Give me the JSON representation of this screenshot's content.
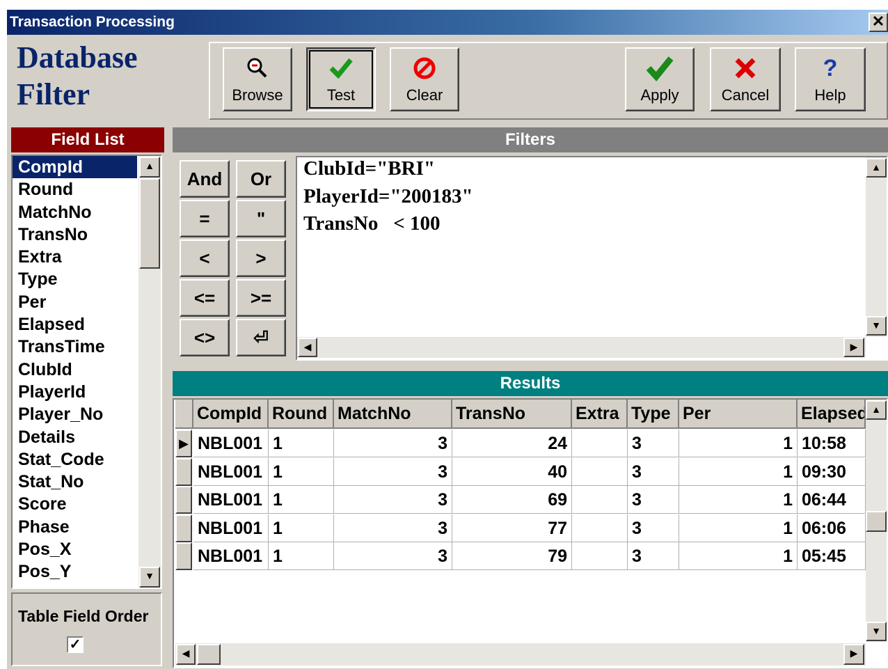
{
  "window": {
    "title": "Transaction Processing",
    "close_glyph": "✕"
  },
  "brand": {
    "line1": "Database",
    "line2": "Filter"
  },
  "toolbar": {
    "browse": "Browse",
    "test": "Test",
    "clear": "Clear",
    "apply": "Apply",
    "cancel": "Cancel",
    "help": "Help"
  },
  "field_list": {
    "header": "Field List",
    "items": [
      "CompId",
      "Round",
      "MatchNo",
      "TransNo",
      "Extra",
      "Type",
      "Per",
      "Elapsed",
      "TransTime",
      "ClubId",
      "PlayerId",
      "Player_No",
      "Details",
      "Stat_Code",
      "Stat_No",
      "Score",
      "Phase",
      "Pos_X",
      "Pos_Y"
    ],
    "selected": "CompId"
  },
  "table_field_order": {
    "label": "Table Field Order",
    "checked": true,
    "check_glyph": "✓"
  },
  "filters": {
    "header": "Filters",
    "operators": [
      "And",
      "Or",
      "=",
      "\"",
      "<",
      ">",
      "<=",
      ">=",
      "<>",
      "⏎"
    ],
    "lines": [
      "ClubId=\"BRI\"",
      "PlayerId=\"200183\"",
      "TransNo   < 100"
    ]
  },
  "results": {
    "header": "Results",
    "columns": [
      "CompId",
      "Round",
      "MatchNo",
      "TransNo",
      "Extra",
      "Type",
      "Per",
      "Elapsed"
    ],
    "rows": [
      [
        "NBL001",
        "1",
        "3",
        "24",
        "",
        "3",
        "1",
        "10:58"
      ],
      [
        "NBL001",
        "1",
        "3",
        "40",
        "",
        "3",
        "1",
        "09:30"
      ],
      [
        "NBL001",
        "1",
        "3",
        "69",
        "",
        "3",
        "1",
        "06:44"
      ],
      [
        "NBL001",
        "1",
        "3",
        "77",
        "",
        "3",
        "1",
        "06:06"
      ],
      [
        "NBL001",
        "1",
        "3",
        "79",
        "",
        "3",
        "1",
        "05:45"
      ]
    ],
    "current_row_marker": "▶"
  },
  "colors": {
    "title_bar": "#0a246a",
    "field_list_header": "#8b0000",
    "filters_header": "#808080",
    "results_header": "#008080",
    "selection": "#0a246a"
  }
}
